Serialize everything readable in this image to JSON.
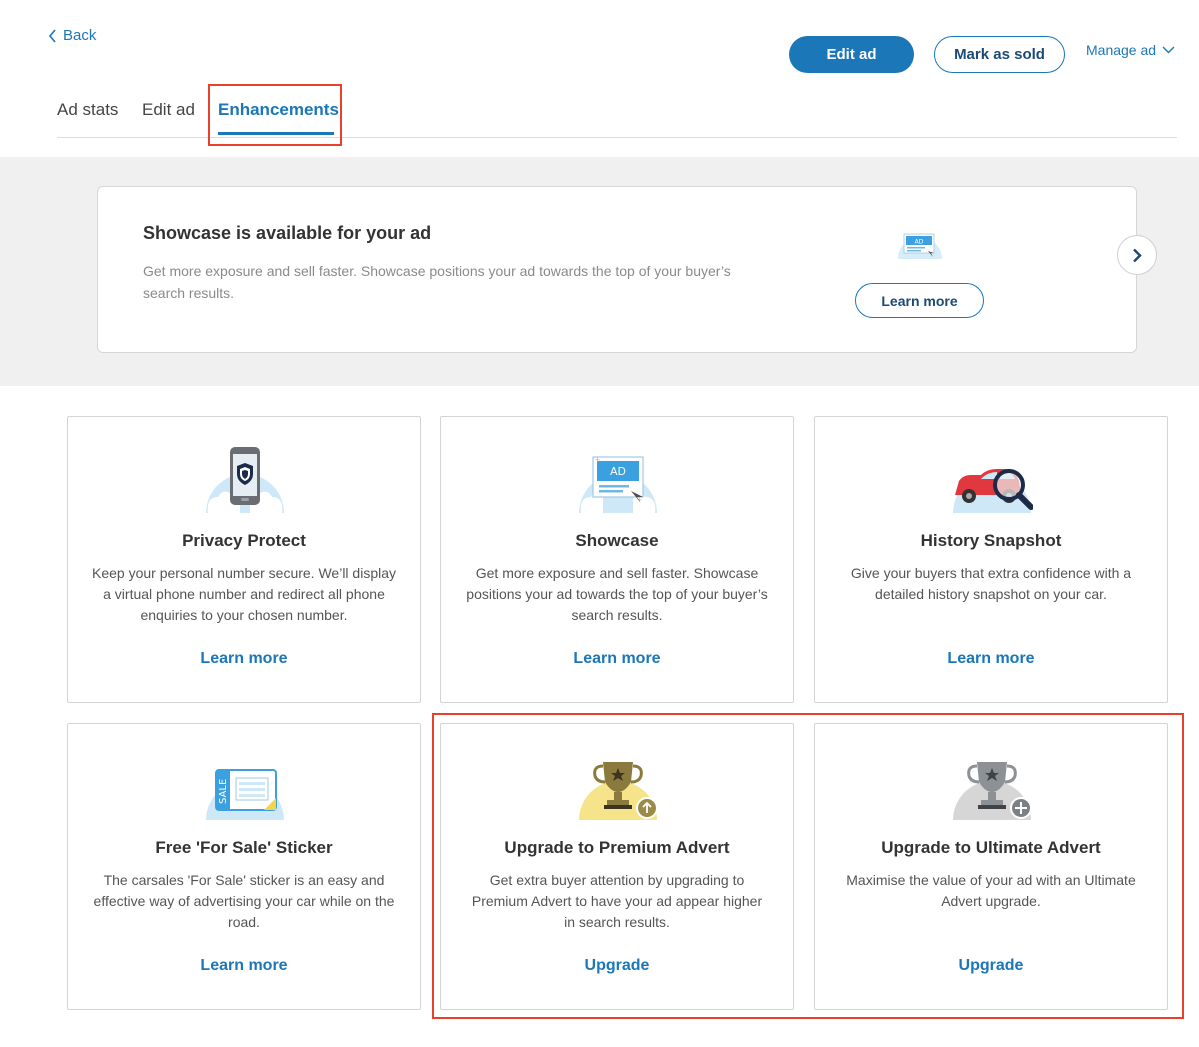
{
  "header": {
    "back_label": "Back",
    "edit_ad_button": "Edit ad",
    "mark_sold_button": "Mark as sold",
    "manage_ad_label": "Manage ad"
  },
  "tabs": [
    {
      "label": "Ad stats",
      "active": false
    },
    {
      "label": "Edit ad",
      "active": false
    },
    {
      "label": "Enhancements",
      "active": true
    }
  ],
  "banner": {
    "title": "Showcase is available for your ad",
    "description": "Get more exposure and sell faster. Showcase positions your ad towards the top of your buyer’s search results.",
    "button_label": "Learn more",
    "icon": "showcase-ad-icon"
  },
  "cards": [
    {
      "title": "Privacy Protect",
      "description": "Keep your personal number secure. We’ll display a virtual phone number and redirect all phone enquiries to your chosen number.",
      "link": "Learn more",
      "icon": "phone-shield-icon"
    },
    {
      "title": "Showcase",
      "description": "Get more exposure and sell faster. Showcase positions your ad towards the top of your buyer’s search results.",
      "link": "Learn more",
      "icon": "showcase-ad-icon"
    },
    {
      "title": "History Snapshot",
      "description": "Give your buyers that extra confidence with a detailed history snapshot on your car.",
      "link": "Learn more",
      "icon": "car-magnifier-icon"
    },
    {
      "title": "Free 'For Sale' Sticker",
      "description": "The carsales 'For Sale' sticker is an easy and effective way of advertising your car while on the road.",
      "link": "Learn more",
      "icon": "sale-sticker-icon"
    },
    {
      "title": "Upgrade to Premium Advert",
      "description": "Get extra buyer attention by upgrading to Premium Advert to have your ad appear higher in search results.",
      "link": "Upgrade",
      "icon": "gold-trophy-upgrade-icon"
    },
    {
      "title": "Upgrade to Ultimate Advert",
      "description": "Maximise the value of your ad with an Ultimate Advert upgrade.",
      "link": "Upgrade",
      "icon": "silver-trophy-add-icon"
    }
  ],
  "colors": {
    "accent": "#1c77b8",
    "highlight": "#e8402a",
    "banner_bg": "#f0f0f0"
  }
}
